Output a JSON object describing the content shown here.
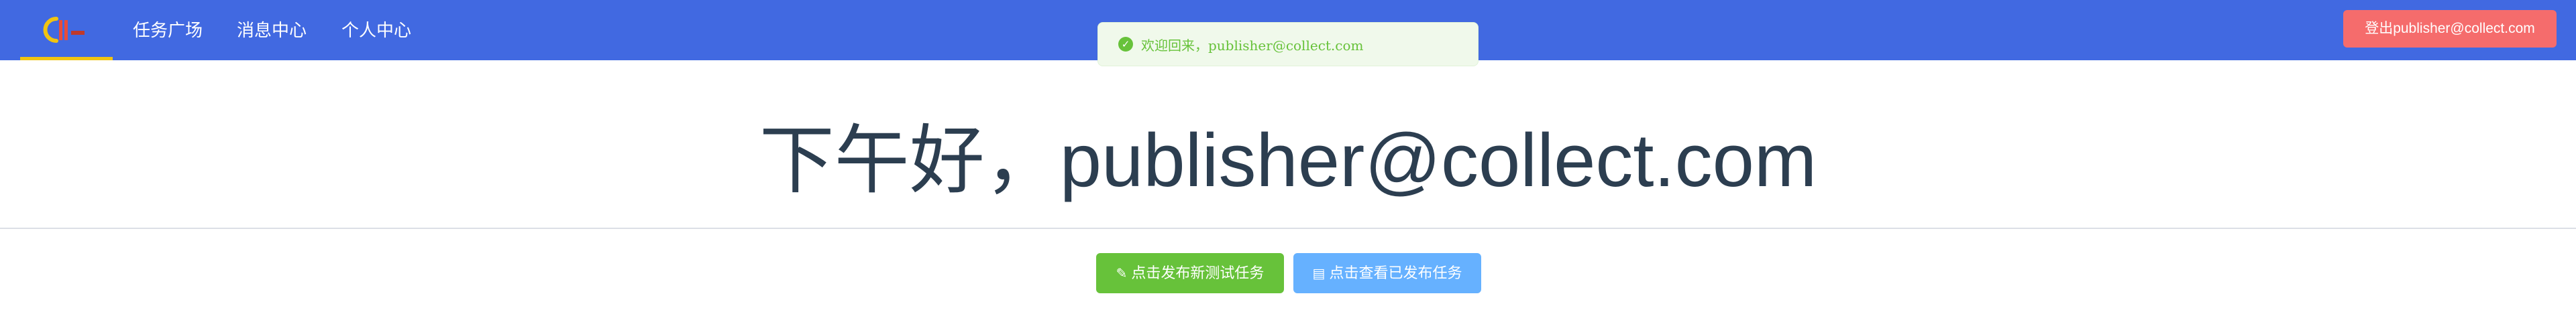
{
  "navbar": {
    "logo": {
      "text": "CII",
      "icon": "app-logo-icon"
    },
    "items": [
      {
        "label": "任务广场"
      },
      {
        "label": "消息中心"
      },
      {
        "label": "个人中心"
      }
    ],
    "logout_label": "登出publisher@collect.com"
  },
  "toast": {
    "icon": "success-check-icon",
    "message": "欢迎回来，publisher@collect.com"
  },
  "main": {
    "greeting": "下午好，publisher@collect.com",
    "actions": [
      {
        "label": "点击发布新测试任务",
        "icon": "edit-icon"
      },
      {
        "label": "点击查看已发布任务",
        "icon": "calendar-icon"
      }
    ]
  },
  "colors": {
    "navbar": "#4169e1",
    "accent_underline": "#f1c40f",
    "logout": "#f56c6c",
    "success": "#67c23a",
    "primary_light": "#66b1ff",
    "text": "#2c3e50"
  }
}
